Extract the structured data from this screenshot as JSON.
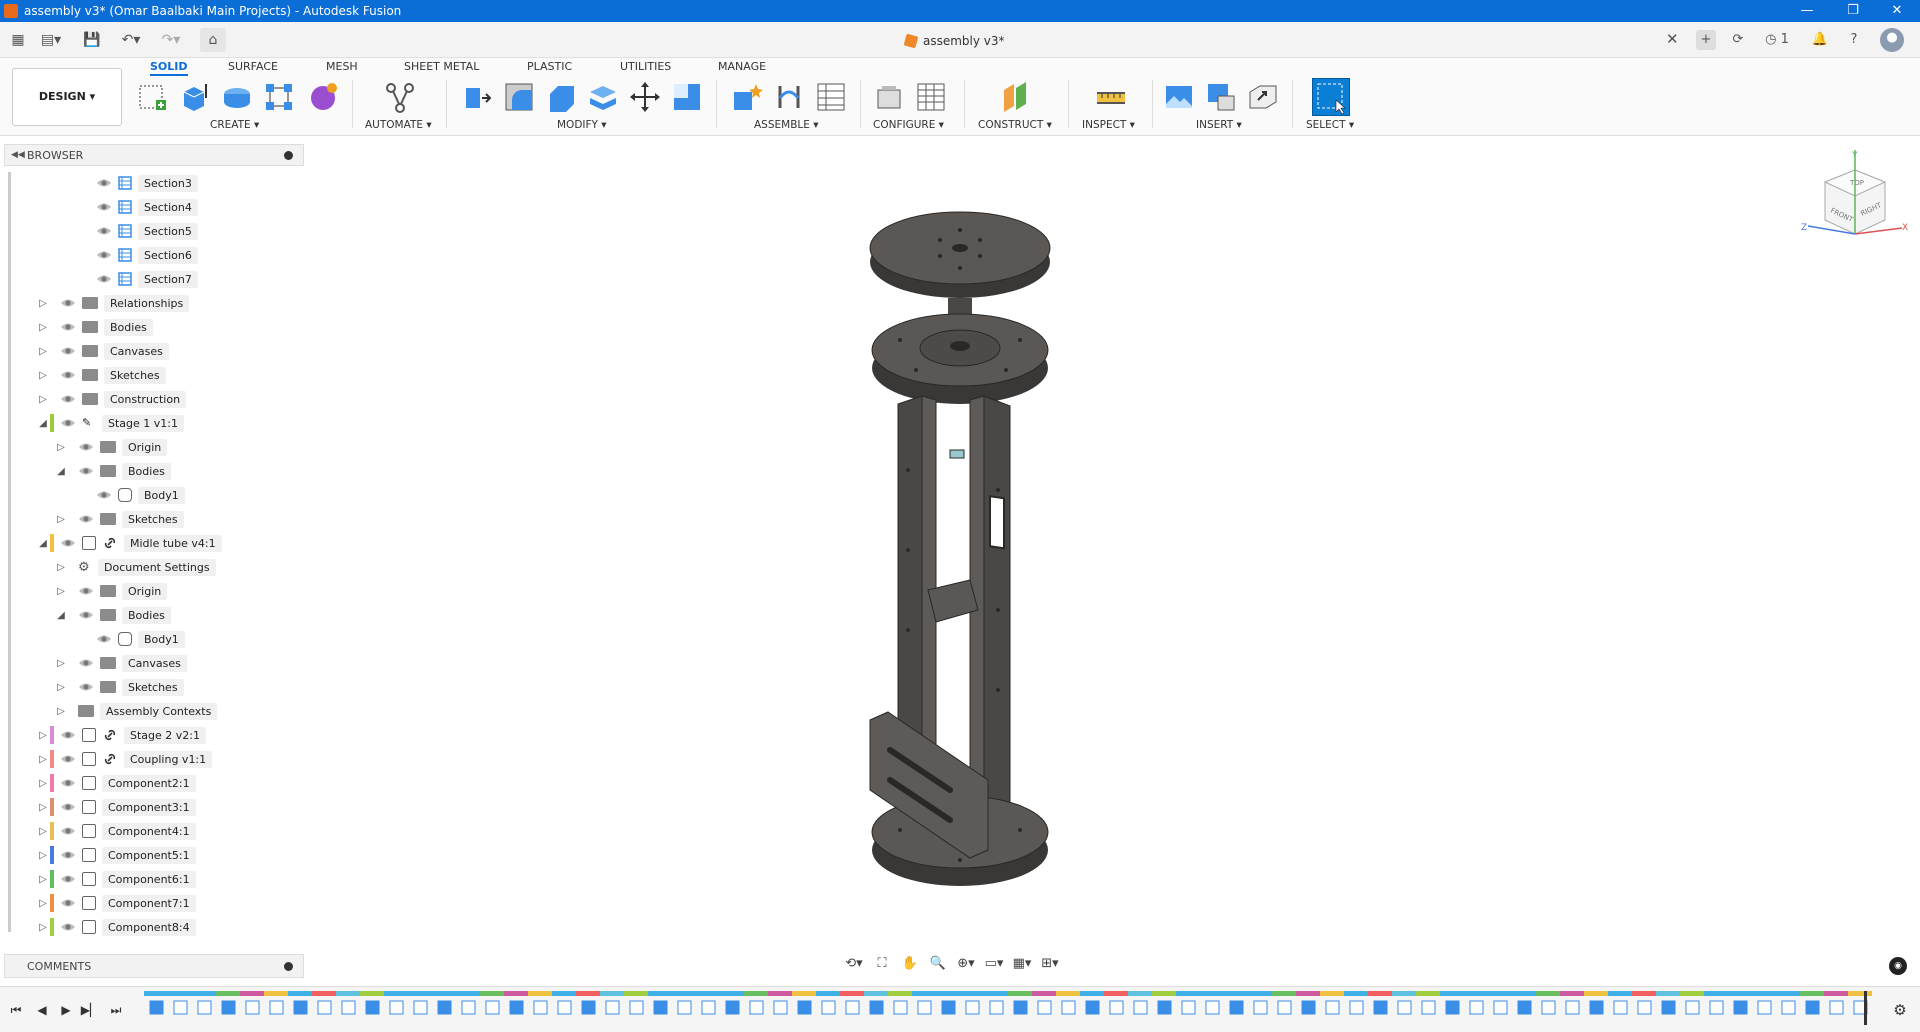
{
  "window": {
    "title": "assembly v3* (Omar Baalbaki Main Projects) - Autodesk Fusion",
    "minimize": "—",
    "maximize": "❐",
    "close": "✕"
  },
  "appbar": {
    "document_tab": "assembly v3*",
    "close_tab": "✕",
    "jobs_count": "1"
  },
  "ribbon": {
    "design_label": "DESIGN ▾",
    "tabs": [
      "SOLID",
      "SURFACE",
      "MESH",
      "SHEET METAL",
      "PLASTIC",
      "UTILITIES",
      "MANAGE"
    ],
    "active_tab": "SOLID",
    "groups": {
      "create": "CREATE ▾",
      "automate": "AUTOMATE ▾",
      "modify": "MODIFY ▾",
      "assemble": "ASSEMBLE ▾",
      "configure": "CONFIGURE ▾",
      "construct": "CONSTRUCT ▾",
      "inspect": "INSPECT ▾",
      "insert": "INSERT ▾",
      "select": "SELECT ▾"
    }
  },
  "browser": {
    "title": "BROWSER",
    "items": [
      {
        "label": "Section3",
        "type": "section",
        "indent": 3,
        "arrow": "",
        "bar": ""
      },
      {
        "label": "Section4",
        "type": "section",
        "indent": 3,
        "arrow": "",
        "bar": ""
      },
      {
        "label": "Section5",
        "type": "section",
        "indent": 3,
        "arrow": "",
        "bar": ""
      },
      {
        "label": "Section6",
        "type": "section",
        "indent": 3,
        "arrow": "",
        "bar": ""
      },
      {
        "label": "Section7",
        "type": "section",
        "indent": 3,
        "arrow": "",
        "bar": ""
      },
      {
        "label": "Relationships",
        "type": "folder",
        "indent": 1,
        "arrow": "▷",
        "bar": ""
      },
      {
        "label": "Bodies",
        "type": "folder",
        "indent": 1,
        "arrow": "▷",
        "bar": ""
      },
      {
        "label": "Canvases",
        "type": "folder",
        "indent": 1,
        "arrow": "▷",
        "bar": ""
      },
      {
        "label": "Sketches",
        "type": "folder",
        "indent": 1,
        "arrow": "▷",
        "bar": ""
      },
      {
        "label": "Construction",
        "type": "folder",
        "indent": 1,
        "arrow": "▷",
        "bar": ""
      },
      {
        "label": "Stage 1 v1:1",
        "type": "component-edit",
        "indent": 1,
        "arrow": "◢",
        "bar": "#9ccc3a"
      },
      {
        "label": "Origin",
        "type": "folder",
        "indent": 2,
        "arrow": "▷",
        "bar": ""
      },
      {
        "label": "Bodies",
        "type": "folder",
        "indent": 2,
        "arrow": "◢",
        "bar": ""
      },
      {
        "label": "Body1",
        "type": "body",
        "indent": 3,
        "arrow": "",
        "bar": ""
      },
      {
        "label": "Sketches",
        "type": "folder",
        "indent": 2,
        "arrow": "▷",
        "bar": ""
      },
      {
        "label": "Midle tube v4:1",
        "type": "component-link",
        "indent": 1,
        "arrow": "◢",
        "bar": "#f0c040"
      },
      {
        "label": "Document Settings",
        "type": "gear",
        "indent": 2,
        "arrow": "▷",
        "bar": ""
      },
      {
        "label": "Origin",
        "type": "folder",
        "indent": 2,
        "arrow": "▷",
        "bar": ""
      },
      {
        "label": "Bodies",
        "type": "folder",
        "indent": 2,
        "arrow": "◢",
        "bar": ""
      },
      {
        "label": "Body1",
        "type": "body",
        "indent": 3,
        "arrow": "",
        "bar": ""
      },
      {
        "label": "Canvases",
        "type": "folder",
        "indent": 2,
        "arrow": "▷",
        "bar": ""
      },
      {
        "label": "Sketches",
        "type": "folder",
        "indent": 2,
        "arrow": "▷",
        "bar": ""
      },
      {
        "label": "Assembly Contexts",
        "type": "folder-only",
        "indent": 2,
        "arrow": "▷",
        "bar": ""
      },
      {
        "label": "Stage 2 v2:1",
        "type": "component-link",
        "indent": 1,
        "arrow": "▷",
        "bar": "#d98ad9"
      },
      {
        "label": "Coupling v1:1",
        "type": "component-link",
        "indent": 1,
        "arrow": "▷",
        "bar": "#f08a8a"
      },
      {
        "label": "Component2:1",
        "type": "component",
        "indent": 1,
        "arrow": "▷",
        "bar": "#f07ab0"
      },
      {
        "label": "Component3:1",
        "type": "component",
        "indent": 1,
        "arrow": "▷",
        "bar": "#e09070"
      },
      {
        "label": "Component4:1",
        "type": "component",
        "indent": 1,
        "arrow": "▷",
        "bar": "#e8c050"
      },
      {
        "label": "Component5:1",
        "type": "component",
        "indent": 1,
        "arrow": "▷",
        "bar": "#4a7ae0"
      },
      {
        "label": "Component6:1",
        "type": "component",
        "indent": 1,
        "arrow": "▷",
        "bar": "#60c060"
      },
      {
        "label": "Component7:1",
        "type": "component",
        "indent": 1,
        "arrow": "▷",
        "bar": "#f09040"
      },
      {
        "label": "Component8:4",
        "type": "component",
        "indent": 1,
        "arrow": "▷",
        "bar": "#a0d040"
      }
    ]
  },
  "comments": {
    "title": "COMMENTS"
  },
  "viewcube": {
    "top": "TOP",
    "front": "FRONT",
    "right": "RIGHT",
    "x": "X",
    "y": "Y",
    "z": "Z"
  },
  "colors": {
    "accent": "#0b6ed6",
    "model": "#5a5754",
    "model_edge": "#2a2826"
  }
}
